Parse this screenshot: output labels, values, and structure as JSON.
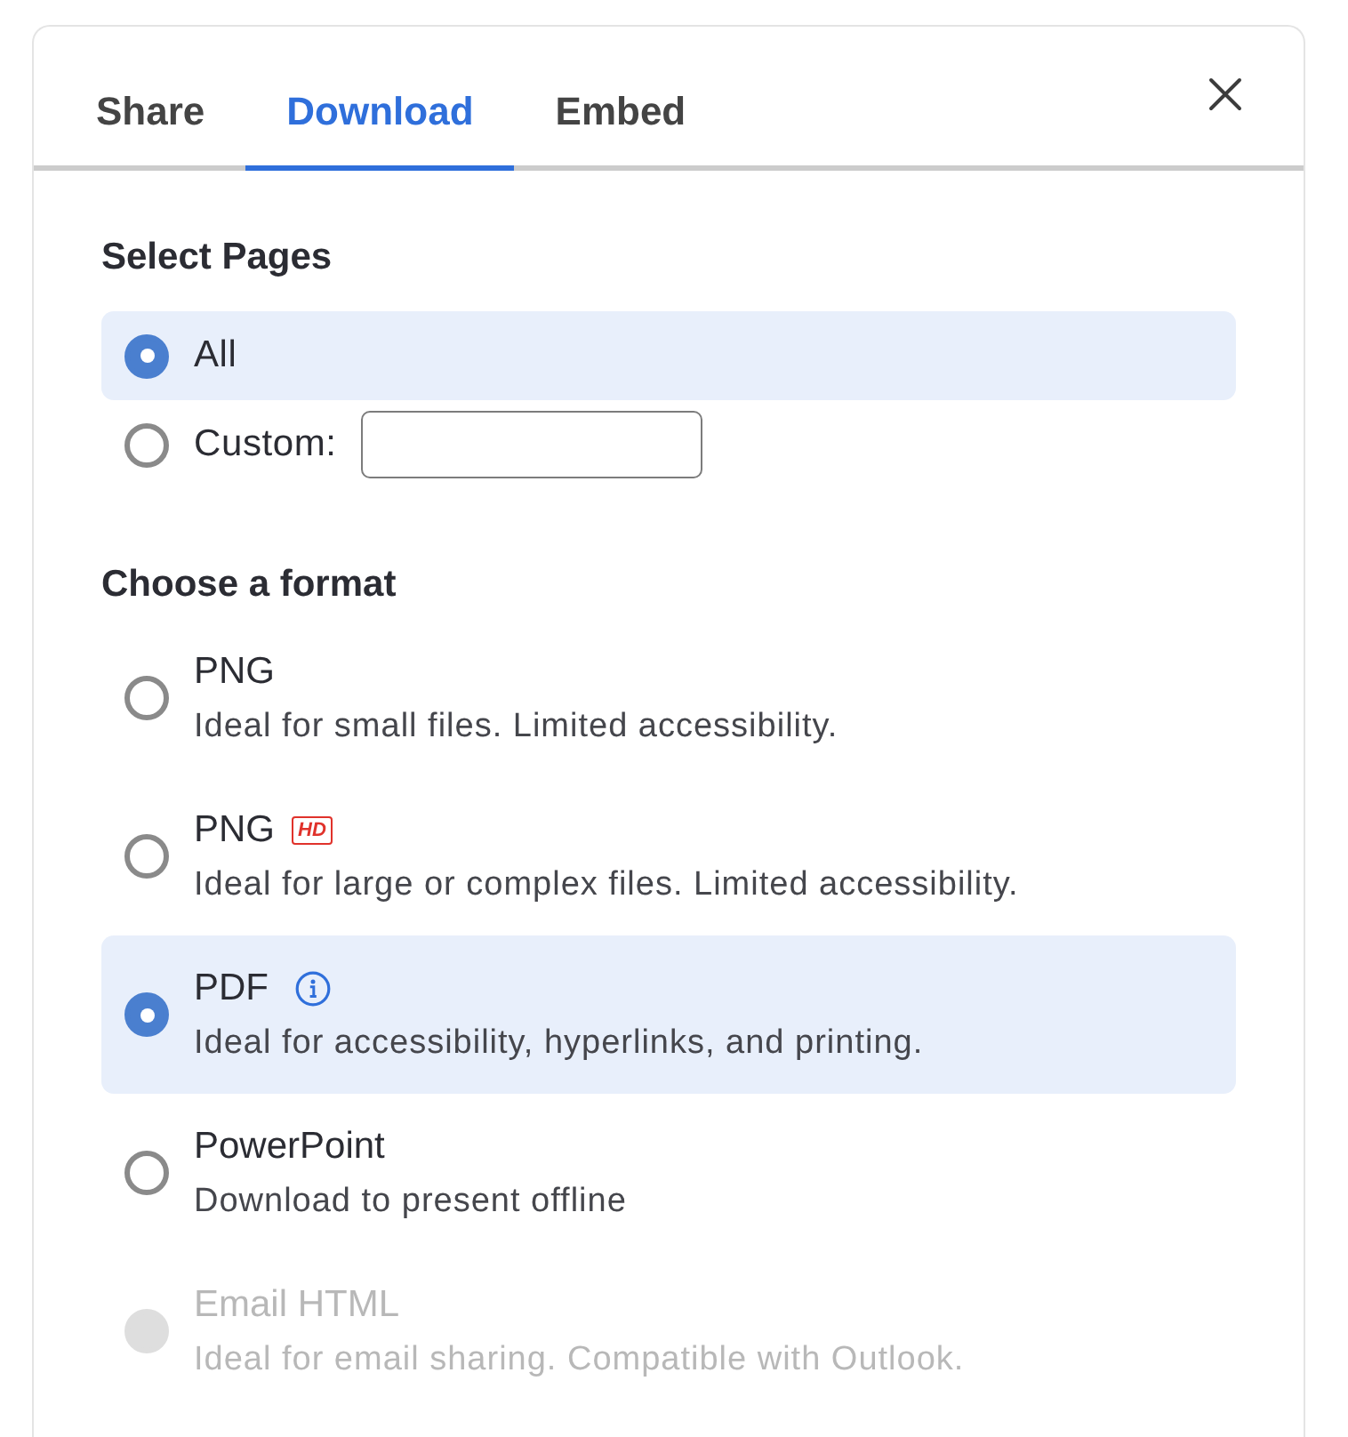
{
  "tabs": [
    {
      "label": "Share",
      "selected": false
    },
    {
      "label": "Download",
      "selected": true
    },
    {
      "label": "Embed",
      "selected": false
    }
  ],
  "select_pages": {
    "heading": "Select Pages",
    "options": [
      {
        "kind": "plain",
        "label": "All",
        "selected": true
      },
      {
        "kind": "custom",
        "label": "Custom:",
        "selected": false
      }
    ]
  },
  "format": {
    "heading": "Choose a format",
    "options": [
      {
        "kind": "plain",
        "title": "PNG",
        "description": "Ideal for small files. Limited accessibility.",
        "selected": false,
        "disabled": false
      },
      {
        "kind": "badge",
        "title": "PNG",
        "badge": "HD",
        "description": "Ideal for large or complex files. Limited accessibility.",
        "selected": false,
        "disabled": false
      },
      {
        "kind": "info",
        "title": "PDF",
        "description": "Ideal for accessibility, hyperlinks, and printing.",
        "selected": true,
        "disabled": false
      },
      {
        "kind": "plain",
        "title": "PowerPoint",
        "description": "Download to present offline",
        "selected": false,
        "disabled": false
      },
      {
        "kind": "plain",
        "title": "Email HTML",
        "description": "Ideal for email sharing. Compatible with Outlook.",
        "selected": false,
        "disabled": true
      }
    ]
  }
}
